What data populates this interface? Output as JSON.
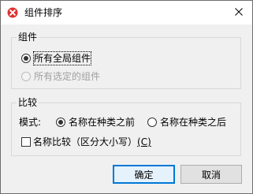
{
  "window": {
    "title": "组件排序",
    "app_icon": "red-x-app-icon",
    "close_icon": "close-x-icon"
  },
  "group_components": {
    "legend": "组件",
    "options": [
      {
        "label": "所有全局组件",
        "selected": true,
        "enabled": true
      },
      {
        "label": "所有选定的组件",
        "selected": false,
        "enabled": false
      }
    ]
  },
  "group_compare": {
    "legend": "比较",
    "mode_label": "模式:",
    "mode_options": [
      {
        "label": "名称在种类之前",
        "selected": true
      },
      {
        "label": "名称在种类之后",
        "selected": false
      }
    ],
    "checkbox": {
      "label": "名称比较（区分大小写）",
      "shortcut": "(C)",
      "checked": false
    }
  },
  "buttons": {
    "ok": "确定",
    "cancel": "取消"
  },
  "colors": {
    "accent": "#0078d7",
    "app_icon": "#e03030",
    "dialog_bg": "#f0f0f0"
  }
}
